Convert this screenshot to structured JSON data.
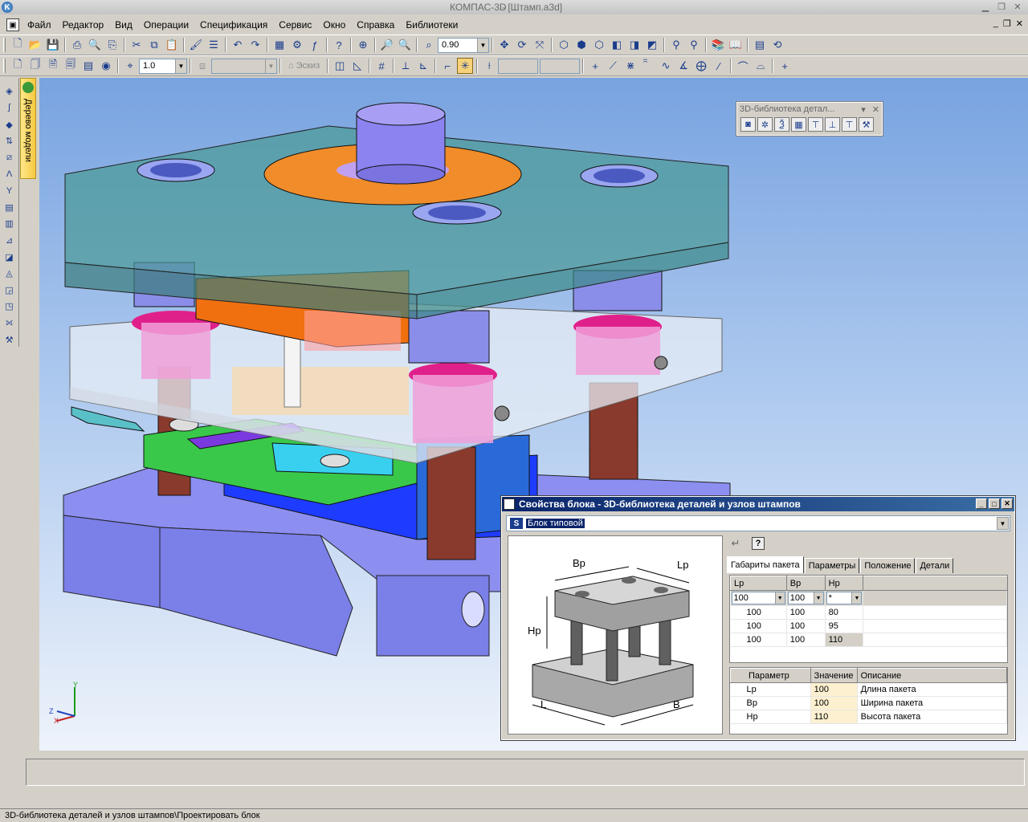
{
  "window": {
    "app_title": "КОМПАС-3D",
    "doc_title": "- [Штамп.a3d]"
  },
  "menu": {
    "items": [
      "Файл",
      "Редактор",
      "Вид",
      "Операции",
      "Спецификация",
      "Сервис",
      "Окно",
      "Справка",
      "Библиотеки"
    ]
  },
  "toolbar": {
    "zoom_value": "0.90",
    "step_value": "1.0",
    "sketch_label": "Эскиз"
  },
  "tree_tab": {
    "label": "Дерево модели"
  },
  "library_panel": {
    "title": "3D-библиотека детал..."
  },
  "dialog": {
    "title": "Свойства блока - 3D-библиотека деталей и узлов штампов",
    "block_type": "Блок типовой",
    "preview_labels": {
      "bp": "Bp",
      "lp": "Lp",
      "hp": "Hp",
      "l": "L",
      "b": "B"
    },
    "tabs": [
      "Габариты пакета",
      "Параметры",
      "Положение",
      "Детали"
    ],
    "grid": {
      "headers": [
        "Lp",
        "Bp",
        "Hp"
      ],
      "filters": [
        "100",
        "100",
        "*"
      ],
      "rows": [
        [
          "100",
          "100",
          "80"
        ],
        [
          "100",
          "100",
          "95"
        ],
        [
          "100",
          "100",
          "110"
        ]
      ]
    },
    "params": {
      "headers": [
        "Параметр",
        "Значение",
        "Описание"
      ],
      "rows": [
        {
          "name": "Lp",
          "value": "100",
          "desc": "Длина пакета"
        },
        {
          "name": "Bp",
          "value": "100",
          "desc": "Ширина пакета"
        },
        {
          "name": "Hp",
          "value": "110",
          "desc": "Высота пакета"
        }
      ]
    }
  },
  "axes": {
    "x": "X",
    "y": "Y",
    "z": "Z"
  },
  "status": {
    "bottom_text": "3D-библиотека деталей и узлов штампов\\Проектировать блок"
  },
  "colors": {
    "viewport_top": "#78a3e0",
    "title_active": "#0a246a",
    "plate_teal": "#4a9a96",
    "plate_orange": "#f08c2a",
    "die_blue": "#7b7fe8",
    "pillar_brown": "#8a3a2c",
    "bushing_pink": "#f0a0d8",
    "green_block": "#3ac84a"
  }
}
